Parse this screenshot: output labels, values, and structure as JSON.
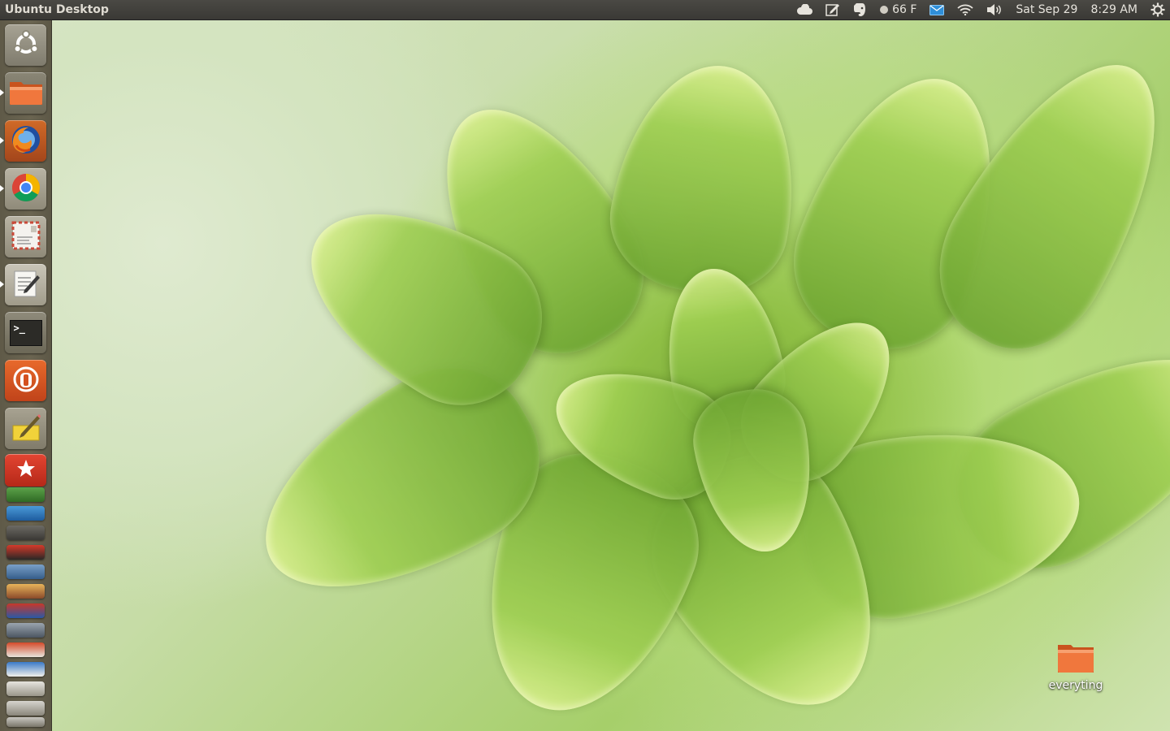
{
  "top_panel": {
    "title": "Ubuntu Desktop",
    "weather": "66 F",
    "date": "Sat Sep 29",
    "time": "8:29 AM"
  },
  "tray_icons": [
    "cloud-icon",
    "notes-icon",
    "evernote-icon",
    "weather-icon",
    "mail-icon",
    "wifi-icon",
    "volume-icon",
    "session-gear-icon"
  ],
  "launcher": {
    "items": [
      {
        "name": "dash-home-button",
        "icon": "ubuntu-logo-icon"
      },
      {
        "name": "files-button",
        "icon": "folder-icon"
      },
      {
        "name": "firefox-button",
        "icon": "firefox-icon"
      },
      {
        "name": "chrome-button",
        "icon": "chrome-icon"
      },
      {
        "name": "mail-app-button",
        "icon": "envelope-icon"
      },
      {
        "name": "text-editor-button",
        "icon": "notepad-icon"
      },
      {
        "name": "terminal-button",
        "icon": "terminal-icon"
      },
      {
        "name": "ubuntu-one-button",
        "icon": "ubuntu-one-icon"
      },
      {
        "name": "notes-app-button",
        "icon": "pencil-icon"
      },
      {
        "name": "bookmark-app-button",
        "icon": "star-icon"
      }
    ],
    "terminal_prompt": ">_"
  },
  "desktop": {
    "icons": [
      {
        "label": "everyting",
        "icon": "folder-icon"
      }
    ]
  },
  "colors": {
    "panel": "#3c3b37",
    "launcher": "#635e4c",
    "accent_orange": "#e95420",
    "wallpaper_green": "#9fcf52"
  }
}
